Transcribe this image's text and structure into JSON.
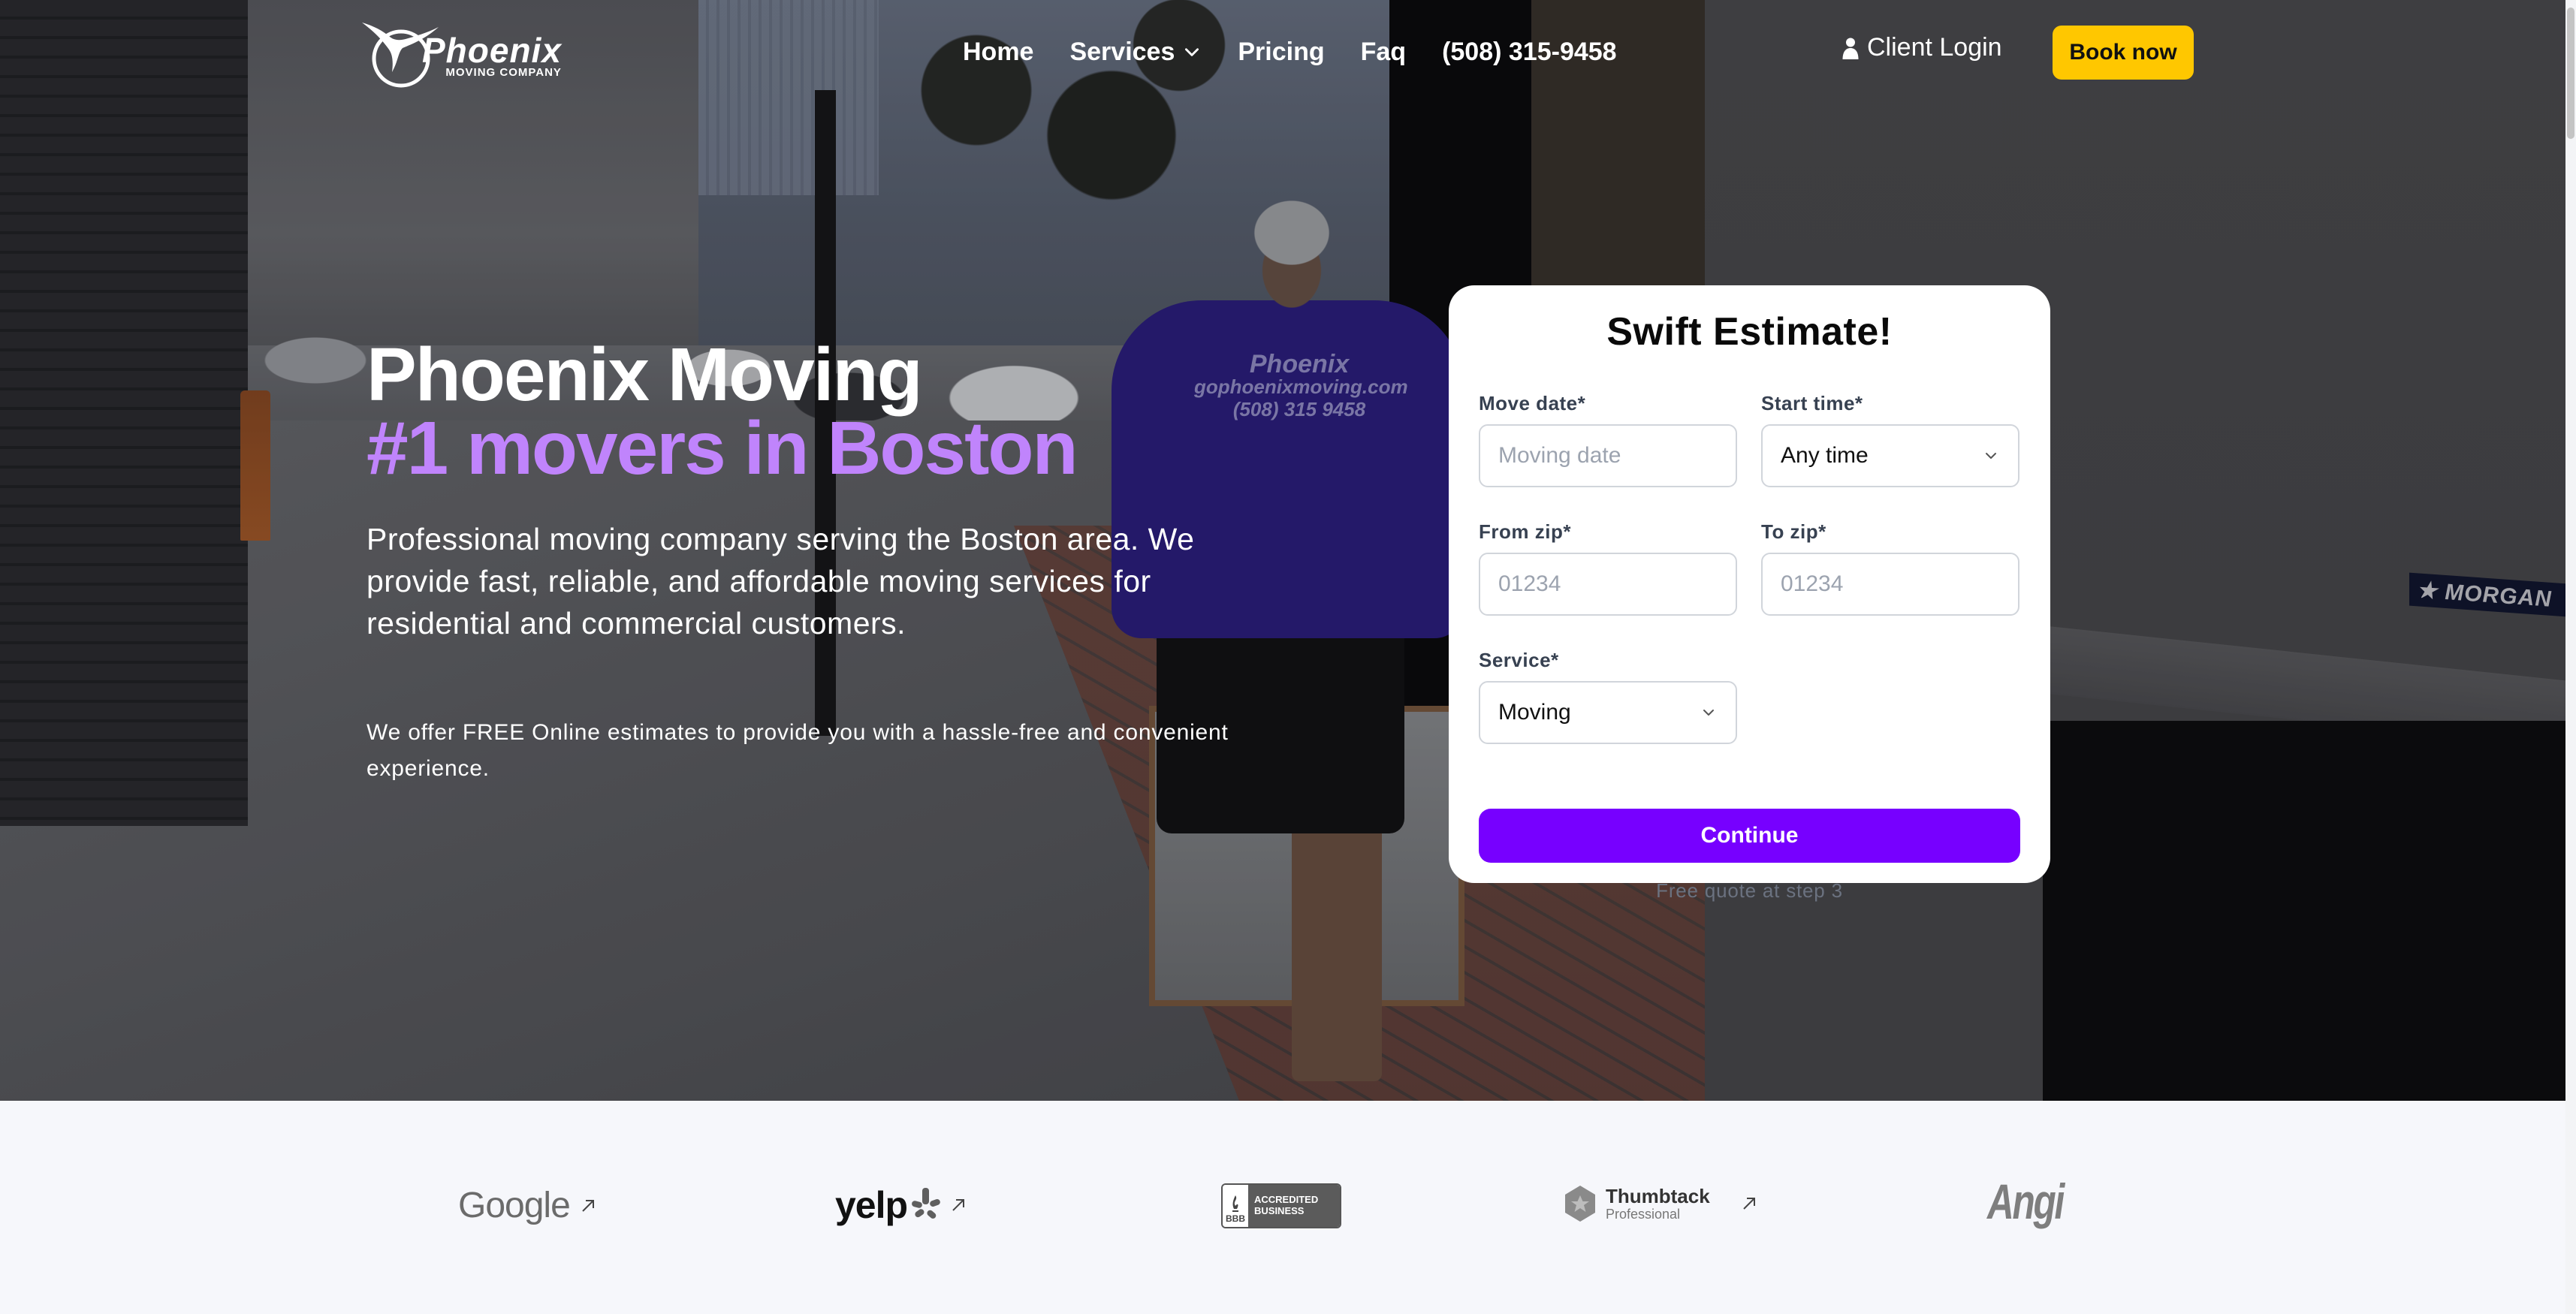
{
  "brand": {
    "name": "Phoenix",
    "tagline": "MOVING COMPANY",
    "accent_purple": "#7700ff",
    "highlight_purple": "#c084fc",
    "cta_yellow": "#ffc700"
  },
  "nav": {
    "items": [
      {
        "label": "Home"
      },
      {
        "label": "Services",
        "has_dropdown": true
      },
      {
        "label": "Pricing"
      },
      {
        "label": "Faq"
      },
      {
        "label": "(508) 315-9458"
      }
    ],
    "client_login": "Client Login",
    "book_now": "Book now"
  },
  "hero": {
    "title_line1": "Phoenix Moving",
    "title_line2": "#1 movers in Boston",
    "description": "Professional moving company serving the Boston area. We provide fast, reliable, and affordable moving services for residential and commercial customers.",
    "note": "We offer FREE Online estimates to provide you with a hassle-free and convenient experience.",
    "photo": {
      "shirt_text_line1": "Phoenix",
      "shirt_text_line2": "gophoenixmoving.com",
      "shirt_text_line3": "(508) 315 9458",
      "truck_label": "★ MORGAN"
    }
  },
  "estimate_form": {
    "title": "Swift Estimate!",
    "fields": {
      "move_date": {
        "label": "Move date*",
        "placeholder": "Moving date",
        "value": ""
      },
      "start_time": {
        "label": "Start time*",
        "value": "Any time"
      },
      "from_zip": {
        "label": "From zip*",
        "placeholder": "01234",
        "value": ""
      },
      "to_zip": {
        "label": "To zip*",
        "placeholder": "01234",
        "value": ""
      },
      "service": {
        "label": "Service*",
        "value": "Moving"
      }
    },
    "submit_label": "Continue",
    "footnote": "Free quote at step 3"
  },
  "review_sites": [
    {
      "name": "Google",
      "icon": "external-link-icon"
    },
    {
      "name": "yelp",
      "icon": "external-link-icon"
    },
    {
      "name": "BBB",
      "badge_line1": "ACCREDITED",
      "badge_line2": "BUSINESS"
    },
    {
      "name": "Thumbtack",
      "subtitle": "Professional",
      "icon": "external-link-icon"
    },
    {
      "name": "Angi"
    }
  ]
}
